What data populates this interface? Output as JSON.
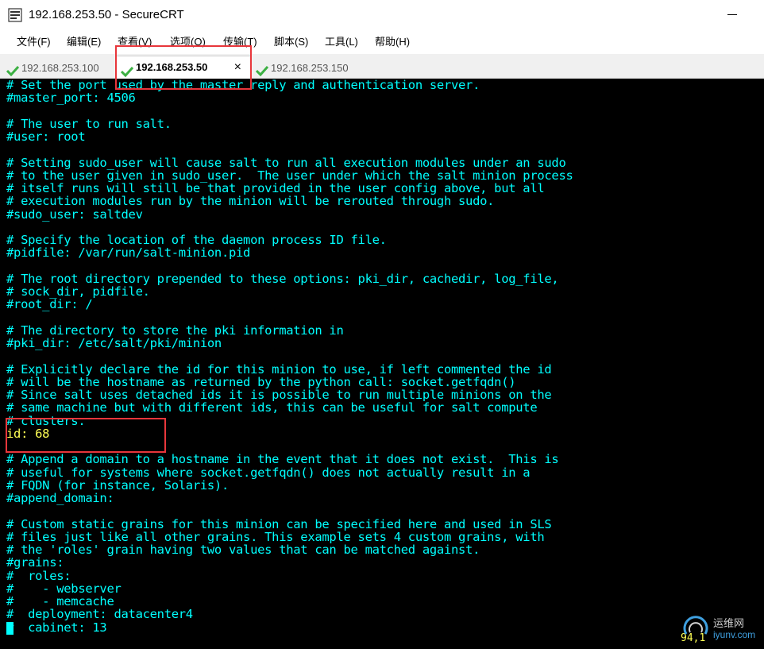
{
  "window": {
    "title": "192.168.253.50 - SecureCRT",
    "app_icon": "securecrt-icon"
  },
  "menu": [
    {
      "label": "文件(F)"
    },
    {
      "label": "编辑(E)"
    },
    {
      "label": "查看(V)"
    },
    {
      "label": "选项(O)"
    },
    {
      "label": "传输(T)"
    },
    {
      "label": "脚本(S)"
    },
    {
      "label": "工具(L)"
    },
    {
      "label": "帮助(H)"
    }
  ],
  "tabs": [
    {
      "label": "192.168.253.100",
      "status_icon": "check-icon",
      "active": false
    },
    {
      "label": "192.168.253.50",
      "status_icon": "check-icon",
      "active": true,
      "close": "×"
    },
    {
      "label": "192.168.253.150",
      "status_icon": "check-icon",
      "active": false
    }
  ],
  "terminal": {
    "lines": [
      {
        "text": "# Set the port used by the master reply and authentication server.",
        "type": "comment"
      },
      {
        "text": "#master_port: 4506",
        "type": "comment"
      },
      {
        "text": "",
        "type": "comment"
      },
      {
        "text": "# The user to run salt.",
        "type": "comment"
      },
      {
        "text": "#user: root",
        "type": "comment"
      },
      {
        "text": "",
        "type": "comment"
      },
      {
        "text": "# Setting sudo_user will cause salt to run all execution modules under an sudo",
        "type": "comment"
      },
      {
        "text": "# to the user given in sudo_user.  The user under which the salt minion process",
        "type": "comment"
      },
      {
        "text": "# itself runs will still be that provided in the user config above, but all",
        "type": "comment"
      },
      {
        "text": "# execution modules run by the minion will be rerouted through sudo.",
        "type": "comment"
      },
      {
        "text": "#sudo_user: saltdev",
        "type": "comment"
      },
      {
        "text": "",
        "type": "comment"
      },
      {
        "text": "# Specify the location of the daemon process ID file.",
        "type": "comment"
      },
      {
        "text": "#pidfile: /var/run/salt-minion.pid",
        "type": "comment"
      },
      {
        "text": "",
        "type": "comment"
      },
      {
        "text": "# The root directory prepended to these options: pki_dir, cachedir, log_file,",
        "type": "comment"
      },
      {
        "text": "# sock_dir, pidfile.",
        "type": "comment"
      },
      {
        "text": "#root_dir: /",
        "type": "comment"
      },
      {
        "text": "",
        "type": "comment"
      },
      {
        "text": "# The directory to store the pki information in",
        "type": "comment"
      },
      {
        "text": "#pki_dir: /etc/salt/pki/minion",
        "type": "comment"
      },
      {
        "text": "",
        "type": "comment"
      },
      {
        "text": "# Explicitly declare the id for this minion to use, if left commented the id",
        "type": "comment"
      },
      {
        "text": "# will be the hostname as returned by the python call: socket.getfqdn()",
        "type": "comment"
      },
      {
        "text": "# Since salt uses detached ids it is possible to run multiple minions on the",
        "type": "comment"
      },
      {
        "text": "# same machine but with different ids, this can be useful for salt compute",
        "type": "comment"
      },
      {
        "text": "# clusters.",
        "type": "comment"
      },
      {
        "text": "id: 68",
        "type": "value"
      },
      {
        "text": "",
        "type": "comment"
      },
      {
        "text": "# Append a domain to a hostname in the event that it does not exist.  This is",
        "type": "comment"
      },
      {
        "text": "# useful for systems where socket.getfqdn() does not actually result in a",
        "type": "comment"
      },
      {
        "text": "# FQDN (for instance, Solaris).",
        "type": "comment"
      },
      {
        "text": "#append_domain:",
        "type": "comment"
      },
      {
        "text": "",
        "type": "comment"
      },
      {
        "text": "# Custom static grains for this minion can be specified here and used in SLS",
        "type": "comment"
      },
      {
        "text": "# files just like all other grains. This example sets 4 custom grains, with",
        "type": "comment"
      },
      {
        "text": "# the 'roles' grain having two values that can be matched against.",
        "type": "comment"
      },
      {
        "text": "#grains:",
        "type": "comment"
      },
      {
        "text": "#  roles:",
        "type": "comment"
      },
      {
        "text": "#    - webserver",
        "type": "comment"
      },
      {
        "text": "#    - memcache",
        "type": "comment"
      },
      {
        "text": "#  deployment: datacenter4",
        "type": "comment"
      },
      {
        "text": "#  cabinet: 13",
        "type": "comment"
      }
    ],
    "cursor_position": "94,1"
  },
  "watermark": {
    "cn": "运维网",
    "en": "iyunv.com"
  },
  "colors": {
    "terminal_bg": "#000000",
    "comment_text": "#00ffff",
    "value_text": "#ffff55",
    "highlight_box": "#e8363b",
    "tab_check": "#3cb043"
  }
}
